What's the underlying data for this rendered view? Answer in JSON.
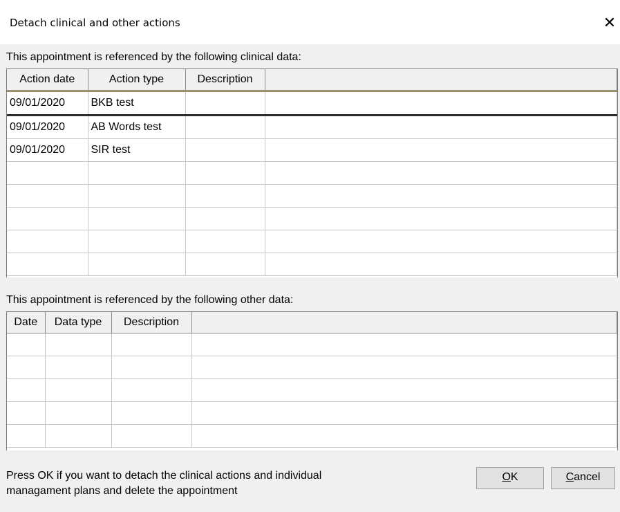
{
  "dialog": {
    "title": "Detach clinical and other actions",
    "close_glyph": "✕"
  },
  "clinical": {
    "label": "This appointment is referenced by the following clinical data:",
    "headers": [
      "Action date",
      "Action type",
      "Description"
    ],
    "rows": [
      [
        "09/01/2020",
        "BKB test",
        ""
      ],
      [
        "09/01/2020",
        "AB Words test",
        ""
      ],
      [
        "09/01/2020",
        "SIR test",
        ""
      ],
      [
        "",
        "",
        ""
      ],
      [
        "",
        "",
        ""
      ],
      [
        "",
        "",
        ""
      ],
      [
        "",
        "",
        ""
      ],
      [
        "",
        "",
        ""
      ]
    ]
  },
  "other": {
    "label": "This appointment is referenced by the following other data:",
    "headers": [
      "Date",
      "Data type",
      "Description"
    ],
    "rows": [
      [
        "",
        "",
        ""
      ],
      [
        "",
        "",
        ""
      ],
      [
        "",
        "",
        ""
      ],
      [
        "",
        "",
        ""
      ],
      [
        "",
        "",
        ""
      ]
    ]
  },
  "footer": {
    "line1": "Press OK if you want to detach the clinical actions and individual",
    "line2": "managament plans and delete the appointment"
  },
  "buttons": {
    "ok_u": "O",
    "ok_rest": "K",
    "cancel_u": "C",
    "cancel_rest": "ancel"
  }
}
